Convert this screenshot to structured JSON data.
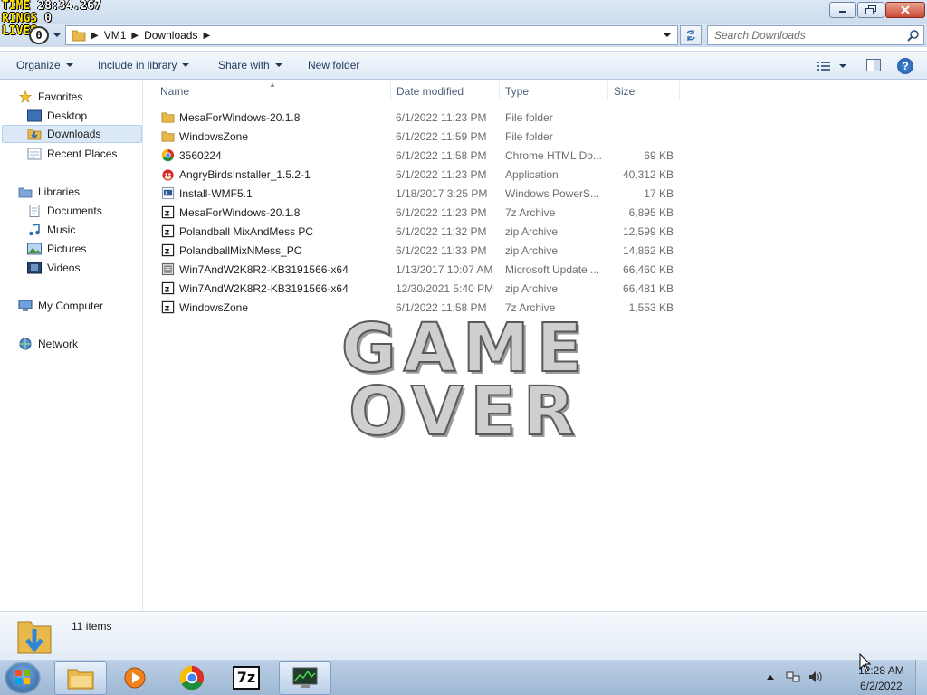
{
  "hud": {
    "time_label": "TIME",
    "time_value": "28:34.267",
    "rings_label": "RINGS",
    "rings_value": "0",
    "lives_label": "LIVES",
    "lives_value": "0",
    "life_badge": "0"
  },
  "address": {
    "crumbs": [
      "VM1",
      "Downloads"
    ]
  },
  "search": {
    "placeholder": "Search Downloads"
  },
  "toolbar": {
    "organize": "Organize",
    "include_in_library": "Include in library",
    "share_with": "Share with",
    "new_folder": "New folder"
  },
  "nav": {
    "favorites": "Favorites",
    "desktop": "Desktop",
    "downloads": "Downloads",
    "recent_places": "Recent Places",
    "libraries": "Libraries",
    "documents": "Documents",
    "music": "Music",
    "pictures": "Pictures",
    "videos": "Videos",
    "my_computer": "My Computer",
    "network": "Network"
  },
  "columns": {
    "name": "Name",
    "date_modified": "Date modified",
    "type": "Type",
    "size": "Size"
  },
  "files": [
    {
      "name": "MesaForWindows-20.1.8",
      "date": "6/1/2022 11:23 PM",
      "type": "File folder",
      "size": "",
      "icon": "folder-icon"
    },
    {
      "name": "WindowsZone",
      "date": "6/1/2022 11:59 PM",
      "type": "File folder",
      "size": "",
      "icon": "folder-icon"
    },
    {
      "name": "3560224",
      "date": "6/1/2022 11:58 PM",
      "type": "Chrome HTML Do...",
      "size": "69 KB",
      "icon": "chrome-icon"
    },
    {
      "name": "AngryBirdsInstaller_1.5.2-1",
      "date": "6/1/2022 11:23 PM",
      "type": "Application",
      "size": "40,312 KB",
      "icon": "angry-birds-icon"
    },
    {
      "name": "Install-WMF5.1",
      "date": "1/18/2017 3:25 PM",
      "type": "Windows PowerS...",
      "size": "17 KB",
      "icon": "powershell-script-icon"
    },
    {
      "name": "MesaForWindows-20.1.8",
      "date": "6/1/2022 11:23 PM",
      "type": "7z Archive",
      "size": "6,895 KB",
      "icon": "archive-icon"
    },
    {
      "name": "Polandball MixAndMess PC",
      "date": "6/1/2022 11:32 PM",
      "type": "zip Archive",
      "size": "12,599 KB",
      "icon": "archive-icon"
    },
    {
      "name": "PolandballMixNMess_PC",
      "date": "6/1/2022 11:33 PM",
      "type": "zip Archive",
      "size": "14,862 KB",
      "icon": "archive-icon"
    },
    {
      "name": "Win7AndW2K8R2-KB3191566-x64",
      "date": "1/13/2017 10:07 AM",
      "type": "Microsoft Update ...",
      "size": "66,460 KB",
      "icon": "update-package-icon"
    },
    {
      "name": "Win7AndW2K8R2-KB3191566-x64",
      "date": "12/30/2021 5:40 PM",
      "type": "zip Archive",
      "size": "66,481 KB",
      "icon": "archive-icon"
    },
    {
      "name": "WindowsZone",
      "date": "6/1/2022 11:58 PM",
      "type": "7z Archive",
      "size": "1,553 KB",
      "icon": "archive-icon"
    }
  ],
  "overlay": {
    "game_over": "GAME OVER"
  },
  "status": {
    "item_count": "11 items"
  },
  "taskbar": {
    "apps": [
      "windows-explorer-icon",
      "media-player-icon",
      "chrome-icon",
      "7zip-icon",
      "task-manager-icon"
    ],
    "app_7z_label": "7z"
  },
  "clock": {
    "time": "12:28 AM",
    "date": "6/2/2022"
  },
  "colors": {
    "accent": "#1e395b",
    "folder": "#e8b84a",
    "selection": "#dbe8f7",
    "hud_yellow": "#ffe400"
  }
}
